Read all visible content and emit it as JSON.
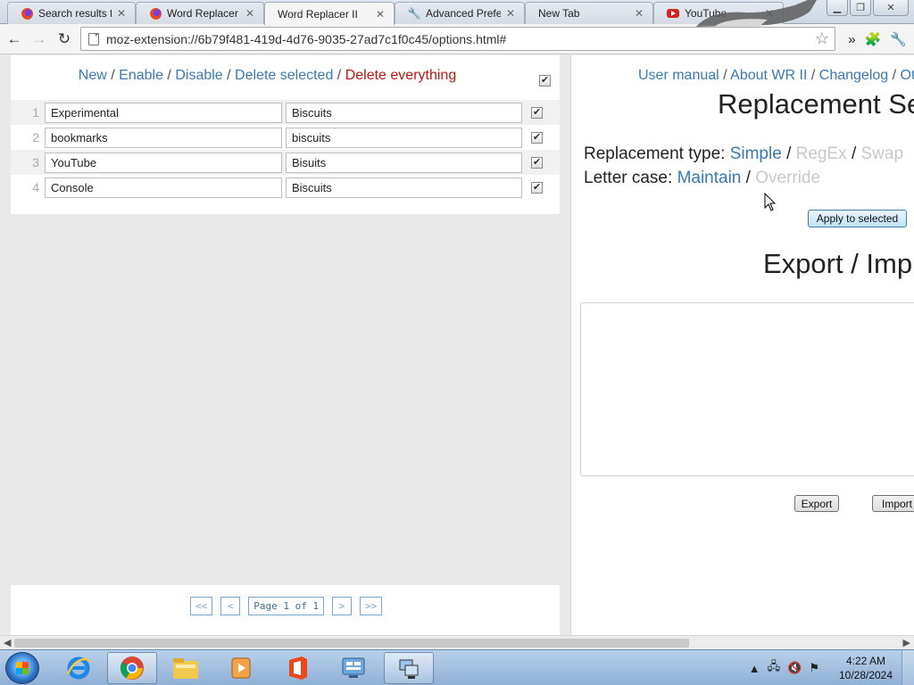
{
  "browser": {
    "tabs": [
      {
        "label": "Search results for",
        "icon": "firefox-icon"
      },
      {
        "label": "Word Replacer – (",
        "icon": "firefox-icon"
      },
      {
        "label": "Word Replacer II",
        "icon": null,
        "active": true
      },
      {
        "label": "Advanced Prefere",
        "icon": "wrench-icon"
      },
      {
        "label": "New Tab",
        "icon": null
      },
      {
        "label": "YouTube",
        "icon": "youtube-icon"
      }
    ],
    "url": "moz-extension://6b79f481-419d-4d76-9035-27ad7c1f0c45/options.html#"
  },
  "list_actions": {
    "new": "New",
    "enable": "Enable",
    "disable": "Disable",
    "delete_selected": "Delete selected",
    "delete_everything": "Delete everything",
    "separator": "/"
  },
  "rules": [
    {
      "num": "1",
      "find": "Experimental",
      "replace": "Biscuits",
      "checked": true
    },
    {
      "num": "2",
      "find": "bookmarks",
      "replace": "biscuits",
      "checked": true
    },
    {
      "num": "3",
      "find": "YouTube",
      "replace": "Bisuits",
      "checked": true
    },
    {
      "num": "4",
      "find": "Console",
      "replace": "Biscuits",
      "checked": true
    }
  ],
  "pagination": {
    "first": "<<",
    "prev": "<",
    "page_label": "Page 1 of 1",
    "next": ">",
    "last": ">>"
  },
  "right": {
    "links": {
      "user_manual": "User manual",
      "about": "About WR II",
      "changelog": "Changelog",
      "more": "Ot"
    },
    "replacement_heading": "Replacement Se",
    "replacement_type_label": "Replacement type:",
    "replacement_types": {
      "simple": "Simple",
      "regex": "RegEx",
      "swap": "Swap"
    },
    "letter_case_label": "Letter case:",
    "letter_cases": {
      "maintain": "Maintain",
      "override": "Override"
    },
    "apply_button": "Apply to selected",
    "export_heading": "Export / Imp",
    "export_button": "Export",
    "import_button": "Import"
  },
  "taskbar": {
    "time": "4:22 AM",
    "date": "10/28/2024"
  },
  "colors": {
    "link": "#3a7ab0",
    "danger": "#c0150f",
    "inactive": "#c8c8c8"
  }
}
